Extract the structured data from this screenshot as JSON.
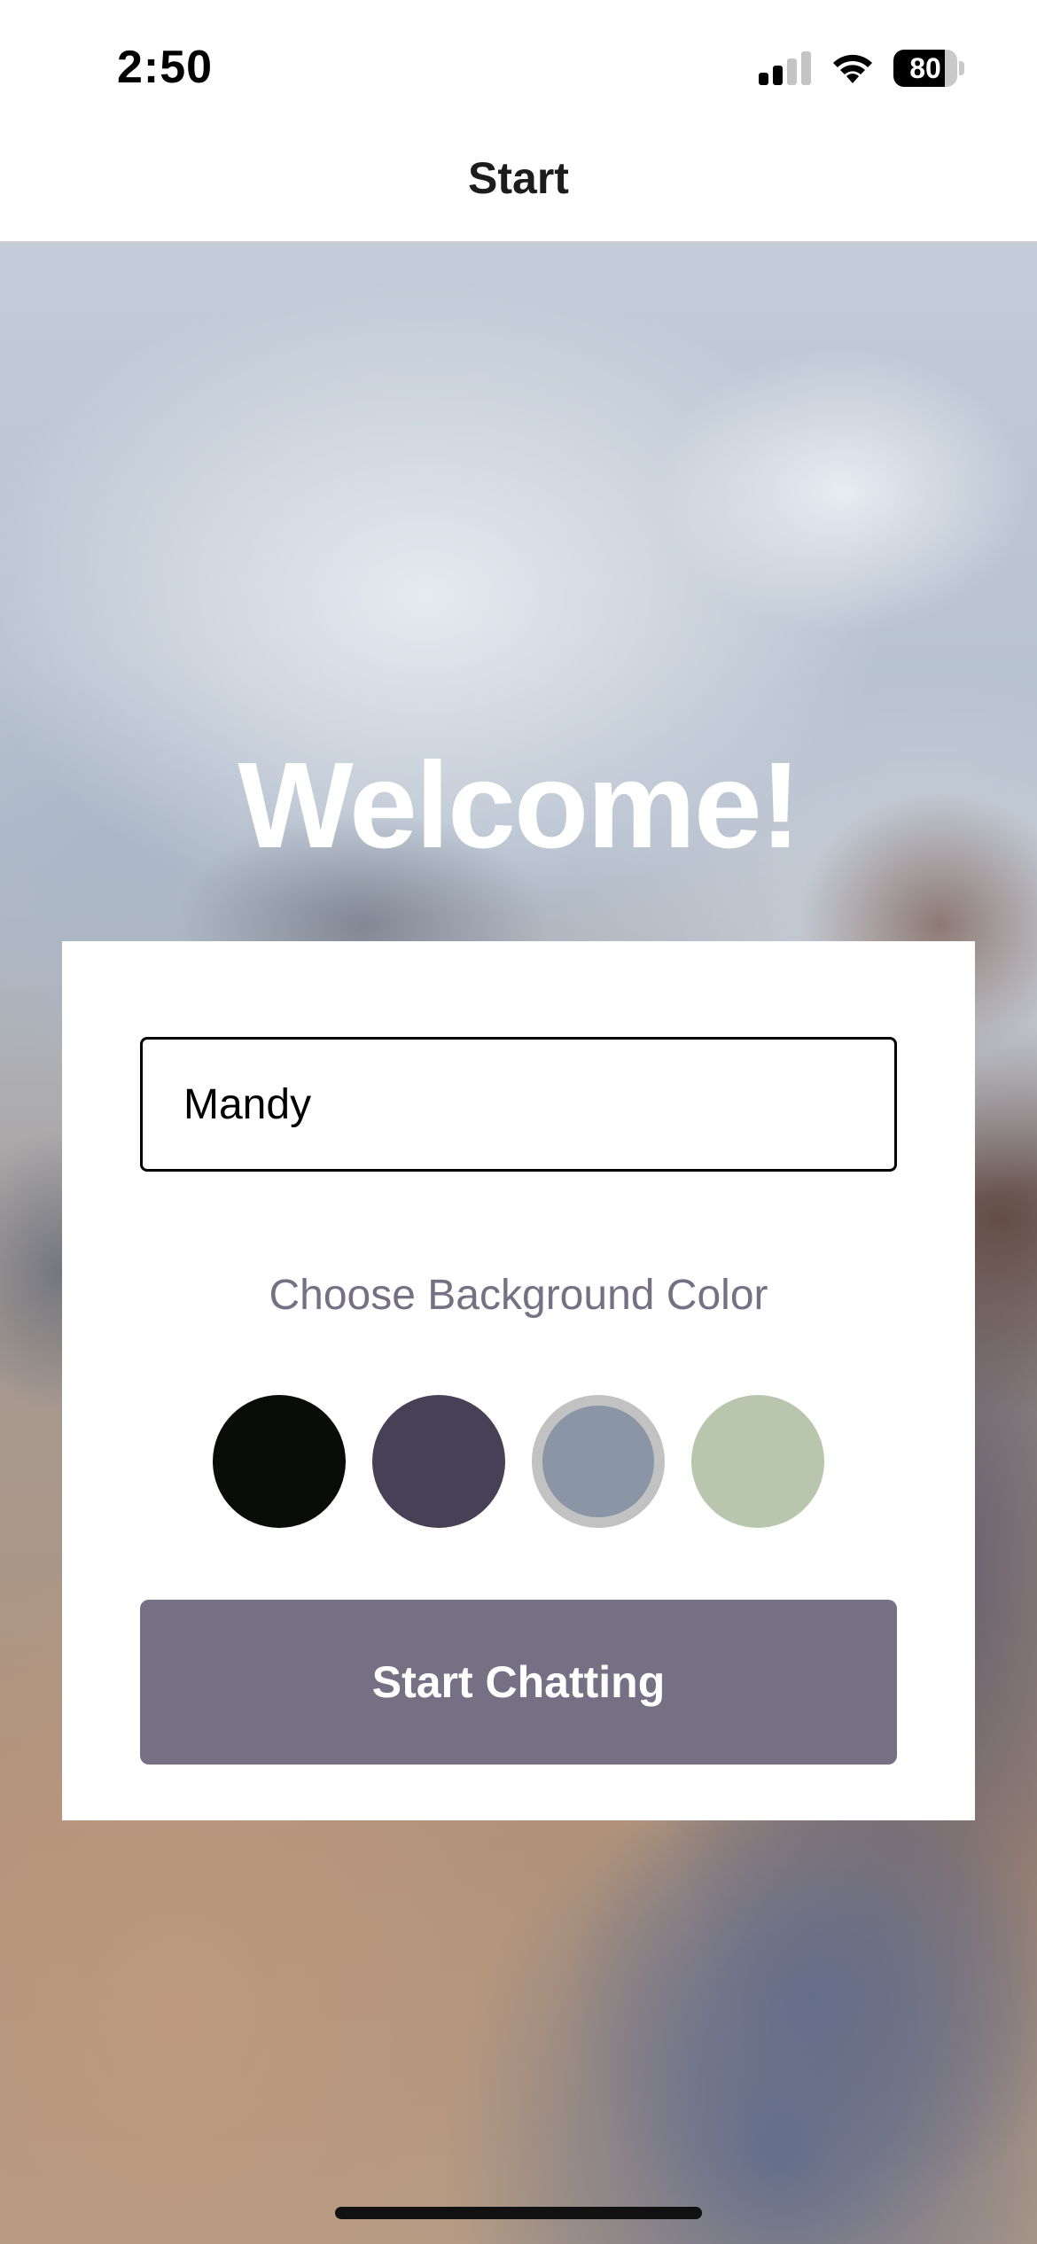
{
  "status_bar": {
    "time": "2:50",
    "battery_level": "80",
    "battery_fraction": 0.8,
    "signal_bars_active": 2,
    "signal_bars_total": 4
  },
  "nav": {
    "title": "Start"
  },
  "welcome": {
    "title": "Welcome!"
  },
  "form": {
    "name_value": "Mandy",
    "color_label": "Choose Background Color",
    "colors": [
      {
        "name": "black",
        "hex": "#090C08",
        "selected": false
      },
      {
        "name": "dark-purple",
        "hex": "#474056",
        "selected": false
      },
      {
        "name": "slate-blue",
        "hex": "#8A95A5",
        "selected": true
      },
      {
        "name": "sage-green",
        "hex": "#B9C6AE",
        "selected": false
      }
    ],
    "button_label": "Start Chatting",
    "button_color": "#757083"
  }
}
